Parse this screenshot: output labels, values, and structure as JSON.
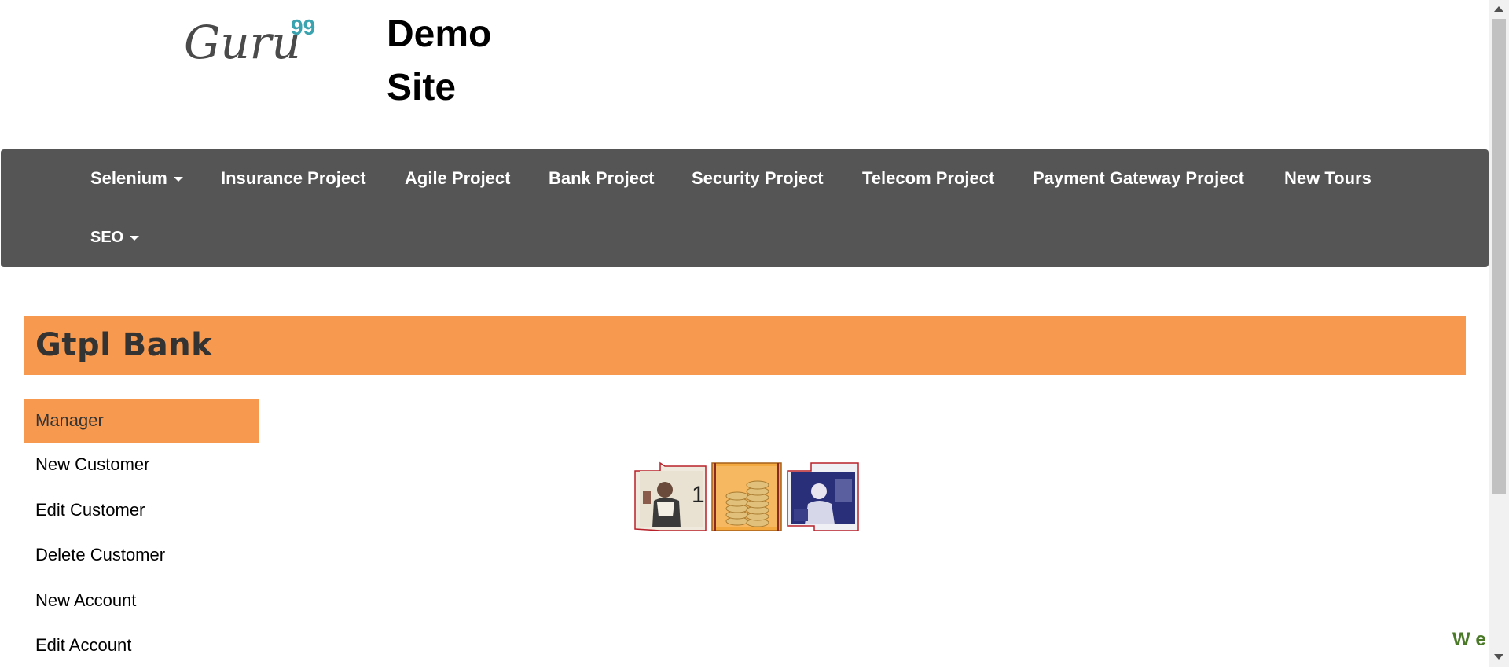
{
  "header": {
    "logo_text": "Guru",
    "logo_superscript": "99",
    "site_title_line1": "Demo",
    "site_title_line2": "Site"
  },
  "navbar": {
    "items": [
      {
        "label": "Selenium",
        "dropdown": true
      },
      {
        "label": "Insurance Project"
      },
      {
        "label": "Agile Project"
      },
      {
        "label": "Bank Project"
      },
      {
        "label": "Security Project"
      },
      {
        "label": "Telecom Project"
      },
      {
        "label": "Payment Gateway Project"
      },
      {
        "label": "New Tours"
      },
      {
        "label": "SEO",
        "dropdown": true
      }
    ]
  },
  "bank": {
    "title": "Gtpl Bank"
  },
  "menu": {
    "items": [
      {
        "label": "Manager",
        "active": true
      },
      {
        "label": "New Customer"
      },
      {
        "label": "Edit Customer"
      },
      {
        "label": "Delete Customer"
      },
      {
        "label": "New Account"
      },
      {
        "label": "Edit Account"
      }
    ]
  },
  "marquee": {
    "text": "W e"
  },
  "colors": {
    "navbar_bg": "#555555",
    "accent_orange": "#f79a50",
    "logo_gray": "#4a4a4a",
    "logo_teal": "#3aa3b0",
    "marquee_green": "#4a7a28"
  }
}
